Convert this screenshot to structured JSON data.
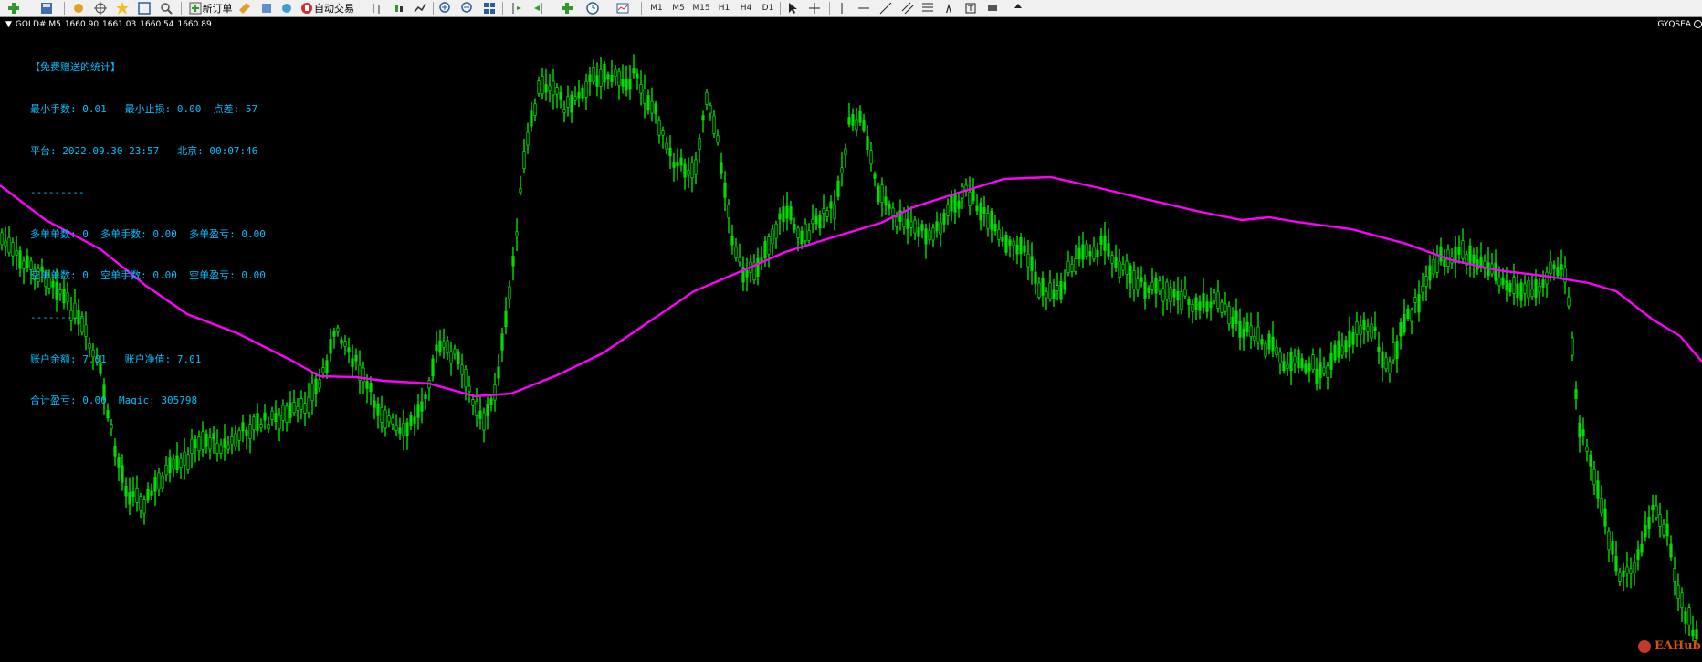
{
  "toolbar": {
    "new_order_label": "新订单",
    "auto_trading_label": "自动交易",
    "timeframes": [
      "M1",
      "M5",
      "M15",
      "H1",
      "H4",
      "D1"
    ]
  },
  "chart_header": {
    "symbol": "GOLD#,M5",
    "open": "1660.90",
    "high": "1661.03",
    "low": "1660.54",
    "close": "1660.89",
    "right_tag": "GYQSEA"
  },
  "stats_panel": {
    "title": "【免费赠送的统计】",
    "min_lot": "最小手数: 0.01",
    "min_stop": "最小止损: 0.00",
    "spread": "点差: 57",
    "platform_time": "平台: 2022.09.30 23:57",
    "beijing_time": "北京: 00:07:46",
    "divider1": "---------",
    "buy_count": "多单单数: 0",
    "buy_lots": "多单手数: 0.00",
    "buy_pnl": "多单盈亏: 0.00",
    "sell_count": "空单单数: 0",
    "sell_lots": "空单手数: 0.00",
    "sell_pnl": "空单盈亏: 0.00",
    "divider2": "---------",
    "balance": "账户余额: 7.01",
    "equity": "账户净值: 7.01",
    "total_pnl": "合计盈亏: 0.00",
    "magic": "Magic: 305798"
  },
  "watermark": {
    "text": "EAHub"
  },
  "colors": {
    "candle": "#00e000",
    "moving_average": "#ff00ff",
    "stats_text": "#00bfff",
    "background": "#000000"
  }
}
